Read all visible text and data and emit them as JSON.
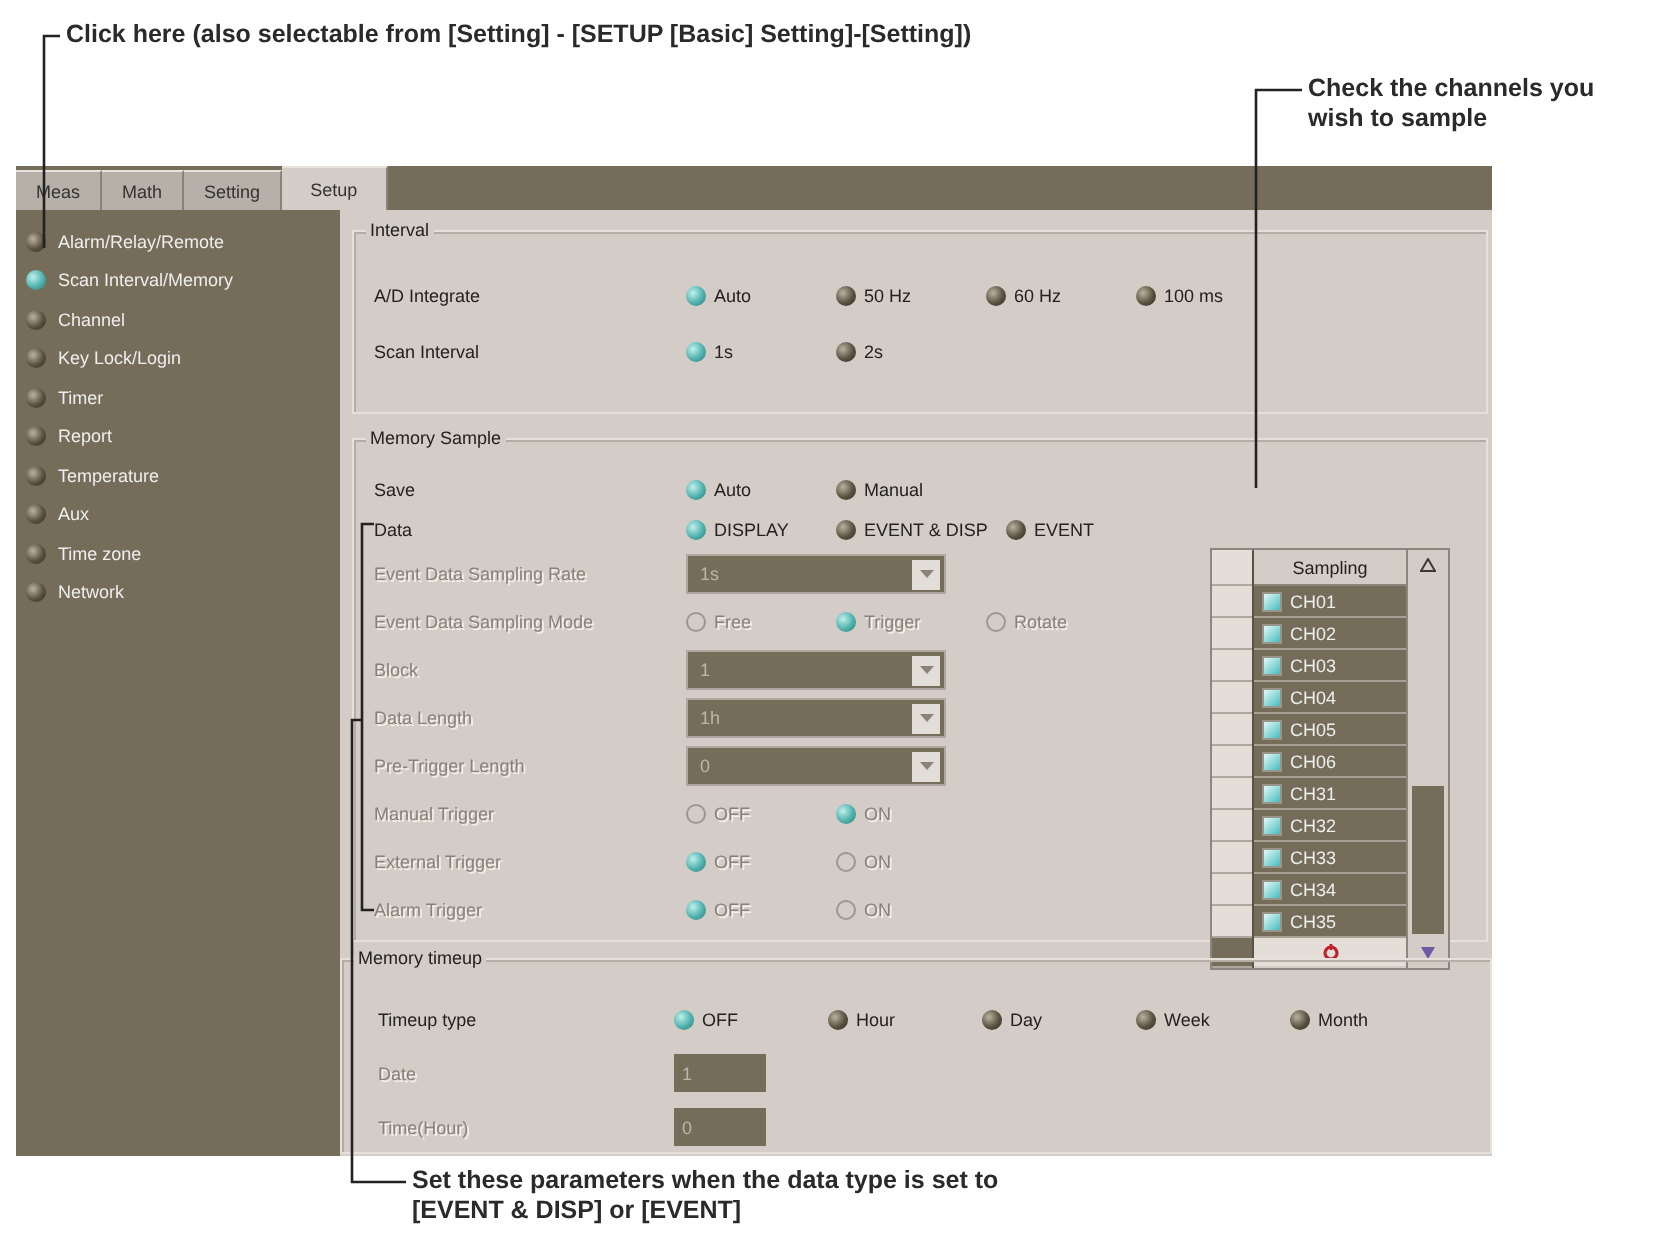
{
  "callouts": [
    {
      "kind": "top",
      "text": "Click here (also selectable from [Setting] - [SETUP [Basic] Setting]-[Setting])"
    },
    {
      "kind": "right",
      "text": "Check the channels you wish to sample"
    },
    {
      "kind": "bottom",
      "text": "Set these parameters when the data type is set to [EVENT & DISP] or [EVENT]"
    }
  ],
  "tabs": [
    {
      "label": "Meas",
      "selected": false
    },
    {
      "label": "Math",
      "selected": false
    },
    {
      "label": "Setting",
      "selected": false
    },
    {
      "label": "Setup",
      "selected": true
    }
  ],
  "sidebar": {
    "items": [
      {
        "label": "Alarm/Relay/Remote",
        "selected": false
      },
      {
        "label": "Scan Interval/Memory",
        "selected": true
      },
      {
        "label": "Channel",
        "selected": false
      },
      {
        "label": "Key Lock/Login",
        "selected": false
      },
      {
        "label": "Timer",
        "selected": false
      },
      {
        "label": "Report",
        "selected": false
      },
      {
        "label": "Temperature",
        "selected": false
      },
      {
        "label": "Aux",
        "selected": false
      },
      {
        "label": "Time zone",
        "selected": false
      },
      {
        "label": "Network",
        "selected": false
      }
    ]
  },
  "interval": {
    "title": "Interval",
    "rows": [
      {
        "kind": "radio",
        "label": "A/D Integrate",
        "disabled": false,
        "options": [
          {
            "label": "Auto",
            "selected": true
          },
          {
            "label": "50 Hz",
            "selected": false
          },
          {
            "label": "60 Hz",
            "selected": false
          },
          {
            "label": "100 ms",
            "selected": false
          }
        ]
      },
      {
        "kind": "radio",
        "label": "Scan Interval",
        "disabled": false,
        "options": [
          {
            "label": "1s",
            "selected": true
          },
          {
            "label": "2s",
            "selected": false
          }
        ]
      }
    ]
  },
  "memory_sample": {
    "title": "Memory Sample",
    "rows": [
      {
        "kind": "radio",
        "label": "Save",
        "disabled": false,
        "options": [
          {
            "label": "Auto",
            "selected": true
          },
          {
            "label": "Manual",
            "selected": false
          }
        ]
      },
      {
        "kind": "radio",
        "label": "Data",
        "disabled": false,
        "options": [
          {
            "label": "DISPLAY",
            "selected": true
          },
          {
            "label": "EVENT & DISP",
            "selected": false
          },
          {
            "label": "EVENT",
            "selected": false
          }
        ]
      },
      {
        "kind": "dropdown",
        "label": "Event Data Sampling Rate",
        "disabled": true,
        "value": "1s"
      },
      {
        "kind": "radio",
        "label": "Event Data Sampling Mode",
        "disabled": true,
        "options": [
          {
            "label": "Free",
            "selected": false
          },
          {
            "label": "Trigger",
            "selected": true
          },
          {
            "label": "Rotate",
            "selected": false
          }
        ]
      },
      {
        "kind": "dropdown",
        "label": "Block",
        "disabled": true,
        "value": "1"
      },
      {
        "kind": "dropdown",
        "label": "Data Length",
        "disabled": true,
        "value": "1h"
      },
      {
        "kind": "dropdown",
        "label": "Pre-Trigger Length",
        "disabled": true,
        "value": "0"
      },
      {
        "kind": "radio",
        "label": "Manual Trigger",
        "disabled": true,
        "options": [
          {
            "label": "OFF",
            "selected": false
          },
          {
            "label": "ON",
            "selected": true
          }
        ]
      },
      {
        "kind": "radio",
        "label": "External Trigger",
        "disabled": true,
        "options": [
          {
            "label": "OFF",
            "selected": true
          },
          {
            "label": "ON",
            "selected": false
          }
        ]
      },
      {
        "kind": "radio",
        "label": "Alarm Trigger",
        "disabled": true,
        "options": [
          {
            "label": "OFF",
            "selected": true
          },
          {
            "label": "ON",
            "selected": false
          }
        ]
      }
    ]
  },
  "channels": {
    "header": "Sampling",
    "rows": [
      {
        "name": "CH01",
        "checked": true
      },
      {
        "name": "CH02",
        "checked": true
      },
      {
        "name": "CH03",
        "checked": true
      },
      {
        "name": "CH04",
        "checked": true
      },
      {
        "name": "CH05",
        "checked": true
      },
      {
        "name": "CH06",
        "checked": true
      },
      {
        "name": "CH31",
        "checked": true
      },
      {
        "name": "CH32",
        "checked": true
      },
      {
        "name": "CH33",
        "checked": true
      },
      {
        "name": "CH34",
        "checked": true
      },
      {
        "name": "CH35",
        "checked": true
      }
    ]
  },
  "memory_timeup": {
    "title": "Memory timeup",
    "rows": [
      {
        "kind": "radio",
        "label": "Timeup type",
        "disabled": false,
        "options": [
          {
            "label": "OFF",
            "selected": true
          },
          {
            "label": "Hour",
            "selected": false
          },
          {
            "label": "Day",
            "selected": false
          },
          {
            "label": "Week",
            "selected": false
          },
          {
            "label": "Month",
            "selected": false
          }
        ]
      },
      {
        "kind": "field",
        "label": "Date",
        "disabled": true,
        "value": "1"
      },
      {
        "kind": "field",
        "label": "Time(Hour)",
        "disabled": true,
        "value": "0"
      }
    ]
  }
}
